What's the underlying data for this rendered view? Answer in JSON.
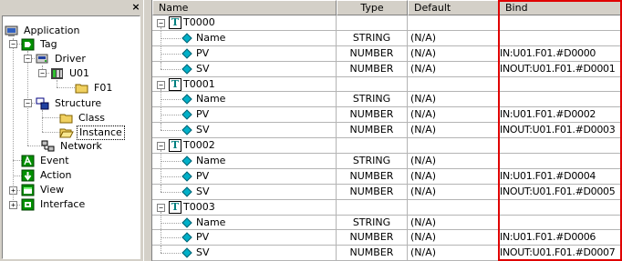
{
  "tree": {
    "items": [
      {
        "label": "Application",
        "icon": "application-icon"
      },
      {
        "label": "Tag",
        "icon": "tag-icon"
      },
      {
        "label": "Driver",
        "icon": "driver-icon"
      },
      {
        "label": "U01",
        "icon": "device-icon"
      },
      {
        "label": "F01",
        "icon": "folder-icon"
      },
      {
        "label": "Structure",
        "icon": "structure-icon"
      },
      {
        "label": "Class",
        "icon": "folder-icon"
      },
      {
        "label": "Instance",
        "icon": "folder-open-icon"
      },
      {
        "label": "Network",
        "icon": "network-icon"
      },
      {
        "label": "Event",
        "icon": "event-icon"
      },
      {
        "label": "Action",
        "icon": "action-icon"
      },
      {
        "label": "View",
        "icon": "view-icon"
      },
      {
        "label": "Interface",
        "icon": "interface-icon"
      }
    ],
    "close_glyph": "×"
  },
  "grid": {
    "headers": {
      "name": "Name",
      "type": "Type",
      "default": "Default",
      "bind": "Bind"
    },
    "rows": [
      {
        "kind": "group",
        "name": "T0000",
        "type": "",
        "default": "",
        "bind": ""
      },
      {
        "kind": "member",
        "name": "Name",
        "type": "STRING",
        "default": "(N/A)",
        "bind": ""
      },
      {
        "kind": "member",
        "name": "PV",
        "type": "NUMBER",
        "default": "(N/A)",
        "bind": "IN:U01.F01.#D0000"
      },
      {
        "kind": "member",
        "name": "SV",
        "type": "NUMBER",
        "default": "(N/A)",
        "bind": "INOUT:U01.F01.#D0001"
      },
      {
        "kind": "group",
        "name": "T0001",
        "type": "",
        "default": "",
        "bind": ""
      },
      {
        "kind": "member",
        "name": "Name",
        "type": "STRING",
        "default": "(N/A)",
        "bind": ""
      },
      {
        "kind": "member",
        "name": "PV",
        "type": "NUMBER",
        "default": "(N/A)",
        "bind": "IN:U01.F01.#D0002"
      },
      {
        "kind": "member",
        "name": "SV",
        "type": "NUMBER",
        "default": "(N/A)",
        "bind": "INOUT:U01.F01.#D0003"
      },
      {
        "kind": "group",
        "name": "T0002",
        "type": "",
        "default": "",
        "bind": ""
      },
      {
        "kind": "member",
        "name": "Name",
        "type": "STRING",
        "default": "(N/A)",
        "bind": ""
      },
      {
        "kind": "member",
        "name": "PV",
        "type": "NUMBER",
        "default": "(N/A)",
        "bind": "IN:U01.F01.#D0004"
      },
      {
        "kind": "member",
        "name": "SV",
        "type": "NUMBER",
        "default": "(N/A)",
        "bind": "INOUT:U01.F01.#D0005"
      },
      {
        "kind": "group",
        "name": "T0003",
        "type": "",
        "default": "",
        "bind": ""
      },
      {
        "kind": "member",
        "name": "Name",
        "type": "STRING",
        "default": "(N/A)",
        "bind": ""
      },
      {
        "kind": "member",
        "name": "PV",
        "type": "NUMBER",
        "default": "(N/A)",
        "bind": "IN:U01.F01.#D0006"
      },
      {
        "kind": "member",
        "name": "SV",
        "type": "NUMBER",
        "default": "(N/A)",
        "bind": "INOUT:U01.F01.#D0007"
      }
    ],
    "group_icon_glyph": "T",
    "expander_glyph": "−"
  },
  "colors": {
    "highlight": "#e00000",
    "tag_green": "#009000",
    "folder_yellow": "#f0d060"
  }
}
